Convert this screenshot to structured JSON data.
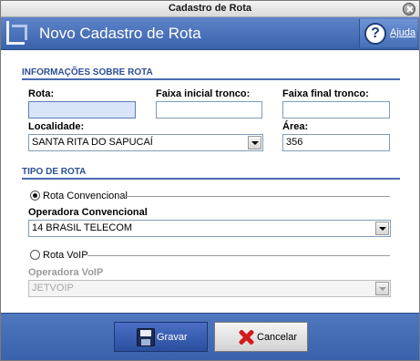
{
  "window": {
    "title": "Cadastro de Rota"
  },
  "header": {
    "title": "Novo Cadastro de Rota",
    "help_label": "Ajuda"
  },
  "section_route": {
    "title": "INFORMAÇÕES SOBRE ROTA",
    "rota_label": "Rota:",
    "rota_value": "",
    "faixa_inicial_label": "Faixa inicial tronco:",
    "faixa_inicial_value": "",
    "faixa_final_label": "Faixa final tronco:",
    "faixa_final_value": "",
    "localidade_label": "Localidade:",
    "localidade_value": "SANTA RITA DO SAPUCAÍ",
    "area_label": "Área:",
    "area_value": "356"
  },
  "section_type": {
    "title": "TIPO DE ROTA",
    "radio_convencional": {
      "label": "Rota Convencional",
      "checked": true
    },
    "operadora_convencional_label": "Operadora Convencional",
    "operadora_convencional_value": "14 BRASIL TELECOM",
    "radio_voip": {
      "label": "Rota VoIP",
      "checked": false
    },
    "operadora_voip_label": "Operadora VoIP",
    "operadora_voip_value": "JETVOIP"
  },
  "footer": {
    "save_label": "Gravar",
    "cancel_label": "Cancelar"
  }
}
